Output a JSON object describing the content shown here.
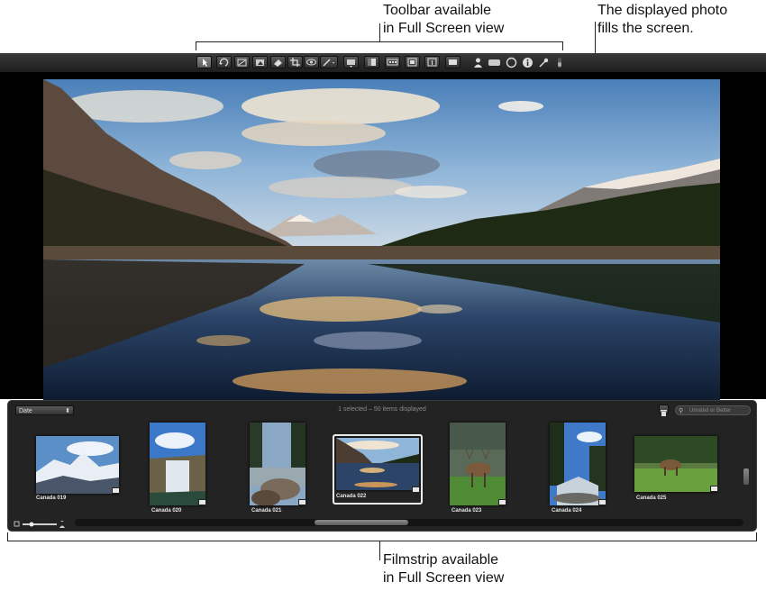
{
  "callouts": {
    "toolbar_line1": "Toolbar available",
    "toolbar_line2": "in Full Screen view",
    "photo_line1": "The displayed photo",
    "photo_line2": "fills the screen.",
    "filmstrip_line1": "Filmstrip available",
    "filmstrip_line2": "in Full Screen view"
  },
  "toolbar": {
    "tools": [
      {
        "name": "select-tool",
        "icon": "arrow-pointer-icon",
        "active": true
      },
      {
        "name": "rotate-tool",
        "icon": "rotate-icon"
      },
      {
        "name": "straighten-tool",
        "icon": "straighten-icon"
      },
      {
        "name": "retouch-tool",
        "icon": "retouch-icon"
      },
      {
        "name": "lift-tool",
        "icon": "lift-icon"
      },
      {
        "name": "crop-tool",
        "icon": "crop-icon"
      },
      {
        "name": "red-eye-tool",
        "icon": "red-eye-icon"
      },
      {
        "name": "brush-tool",
        "icon": "brush-icon"
      },
      {
        "name": "view-menu",
        "icon": "view-icon"
      },
      {
        "name": "layout-1",
        "icon": "layout-icon"
      },
      {
        "name": "layout-2",
        "icon": "filmstrip-layout-icon"
      },
      {
        "name": "layout-3",
        "icon": "viewer-layout-icon"
      },
      {
        "name": "layout-4",
        "icon": "split-layout-icon"
      },
      {
        "name": "layout-5",
        "icon": "browser-layout-icon"
      }
    ],
    "right_icons": [
      "person-icon",
      "loupe-rect-icon",
      "loupe-circle-icon",
      "info-icon",
      "pin-icon",
      "scroll-icon"
    ]
  },
  "filmstrip": {
    "sort_by": "Date",
    "status": "1 selected – 50 items displayed",
    "filter_placeholder": "Unrated or Better",
    "thumbnails": [
      {
        "caption": "Canada 019",
        "scene": "glacier"
      },
      {
        "caption": "Canada 020",
        "scene": "waterfall"
      },
      {
        "caption": "Canada 021",
        "scene": "rocks"
      },
      {
        "caption": "Canada 022",
        "scene": "lake",
        "selected": true
      },
      {
        "caption": "Canada 023",
        "scene": "elk"
      },
      {
        "caption": "Canada 024",
        "scene": "stream"
      },
      {
        "caption": "Canada 025",
        "scene": "elk-meadow"
      }
    ]
  }
}
